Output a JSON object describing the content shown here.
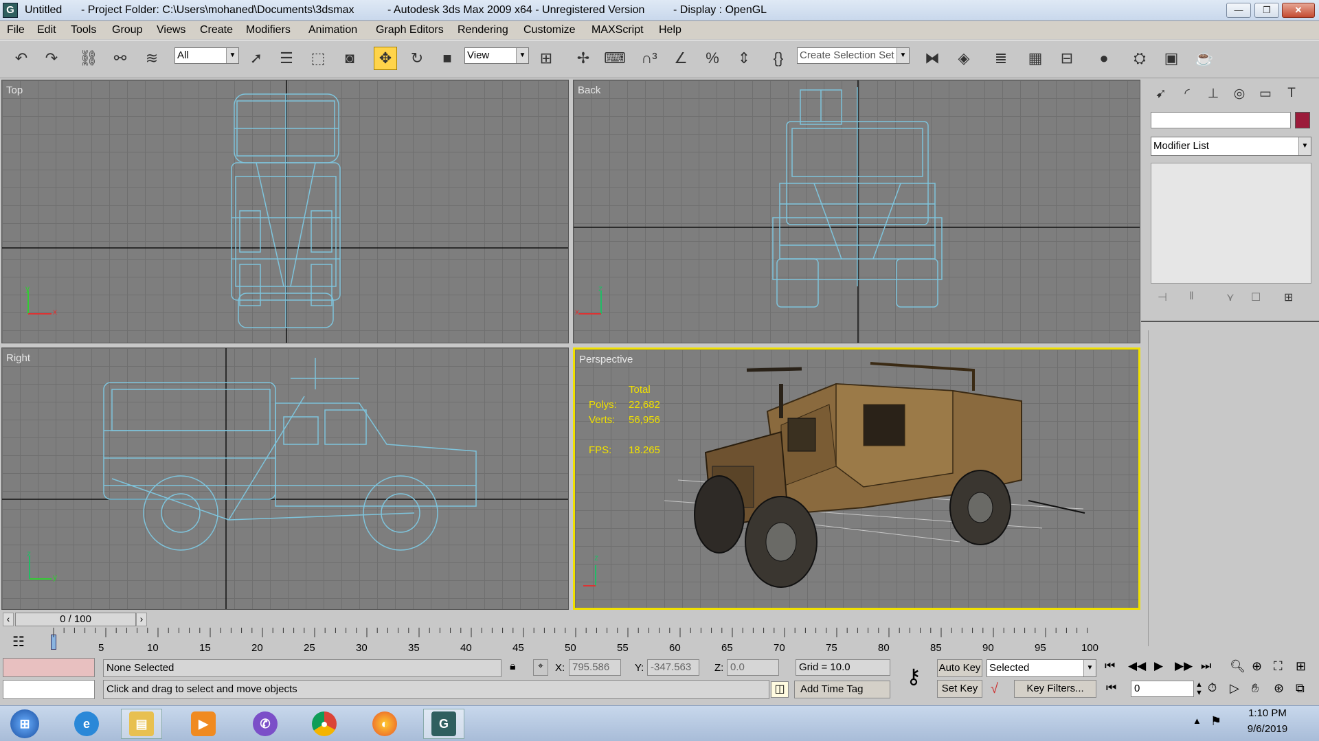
{
  "window": {
    "title_segments": [
      "Untitled",
      "- Project Folder: C:\\Users\\mohaned\\Documents\\3dsmax",
      "- Autodesk 3ds Max  2009 x64  - Unregistered Version",
      "- Display : OpenGL"
    ],
    "app_icon": "G",
    "controls": {
      "minimize": "—",
      "restore": "❐",
      "close": "✕"
    }
  },
  "menu": [
    "File",
    "Edit",
    "Tools",
    "Group",
    "Views",
    "Create",
    "Modifiers",
    "Animation",
    "Graph Editors",
    "Rendering",
    "Customize",
    "MAXScript",
    "Help"
  ],
  "toolbar": {
    "filter_value": "All",
    "ref_coord_value": "View",
    "selection_set_placeholder": "Create Selection Set",
    "icons": [
      "undo-icon",
      "redo-icon",
      "select-link-icon",
      "unlink-icon",
      "bind-space-warp-icon",
      "select-object-icon",
      "select-by-name-icon",
      "rect-select-icon",
      "window-crossing-icon",
      "move-icon",
      "rotate-icon",
      "scale-icon",
      "pivot-icon",
      "manipulate-icon",
      "keyboard-shortcut-icon",
      "snap-3-icon",
      "angle-snap-icon",
      "percent-snap-icon",
      "spinner-snap-icon",
      "named-selection-icon",
      "mirror-icon",
      "align-icon",
      "layer-manager-icon",
      "curve-editor-icon",
      "schematic-icon",
      "material-editor-icon",
      "render-setup-icon",
      "rendered-frame-icon",
      "quick-render-icon"
    ]
  },
  "viewports": {
    "top": {
      "label": "Top"
    },
    "back": {
      "label": "Back"
    },
    "right": {
      "label": "Right"
    },
    "perspective": {
      "label": "Perspective",
      "stats": {
        "header": "Total",
        "polys_label": "Polys:",
        "polys": "22,682",
        "verts_label": "Verts:",
        "verts": "56,956",
        "fps_label": "FPS:",
        "fps": "18.265"
      }
    },
    "axis": {
      "x": "x",
      "y": "y",
      "z": "z"
    }
  },
  "command_panel": {
    "tabs": [
      "create-tab-icon",
      "modify-tab-icon",
      "hierarchy-tab-icon",
      "motion-tab-icon",
      "display-tab-icon",
      "utilities-tab-icon"
    ],
    "name_value": "",
    "object_color": "#9b1b3a",
    "modifier_list": "Modifier List"
  },
  "time": {
    "slider_label": "0 / 100",
    "slider_fraction": 0.0,
    "ticks": [
      "5",
      "10",
      "15",
      "20",
      "25",
      "30",
      "35",
      "40",
      "45",
      "50",
      "55",
      "60",
      "65",
      "70",
      "75",
      "80",
      "85",
      "90",
      "95",
      "100"
    ],
    "first_tick": "0"
  },
  "status": {
    "selection": "None Selected",
    "prompt": "Click and drag to select and move objects",
    "x_label": "X:",
    "x": "795.586",
    "y_label": "Y:",
    "y": "-347.563",
    "z_label": "Z:",
    "z": "0.0",
    "grid": "Grid = 10.0",
    "add_time_tag": "Add Time Tag",
    "auto_key": "Auto Key",
    "set_key": "Set Key",
    "key_mode": "Selected",
    "key_filters": "Key Filters...",
    "frame": "0"
  },
  "taskbar": {
    "apps": [
      "start-icon",
      "internet-explorer-icon",
      "file-explorer-icon",
      "media-player-icon",
      "viber-icon",
      "chrome-icon",
      "firefox-icon",
      "3dsmax-icon"
    ],
    "time": "1:10 PM",
    "date": "9/6/2019"
  },
  "colors": {
    "wire": "#7ec4dc",
    "active_border": "#f0e000",
    "stats": "#f0e000",
    "auto_key_color": "#e8c0c0"
  }
}
